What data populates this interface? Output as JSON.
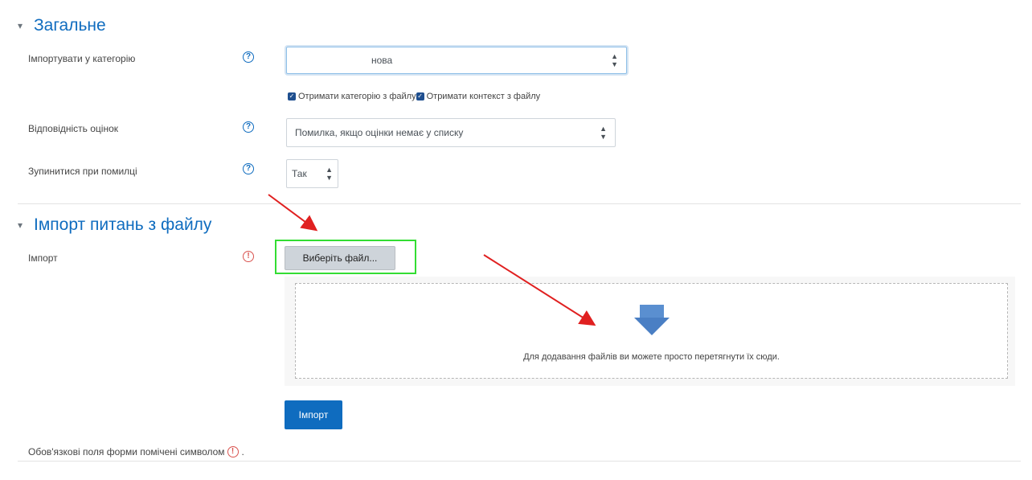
{
  "general": {
    "title": "Загальне",
    "chevron": "chevron-down-icon",
    "import_category": {
      "label": "Імпортувати у категорію",
      "value": "нова",
      "help": "?"
    },
    "checkboxes": [
      {
        "label": "Отримати категорію з файлу",
        "checked": true
      },
      {
        "label": "Отримати контекст з файлу",
        "checked": true
      }
    ],
    "grade_match": {
      "label": "Відповідність оцінок",
      "value": "Помилка, якщо оцінки немає у списку",
      "help": "?"
    },
    "stop_on_error": {
      "label": "Зупинитися при помилці",
      "value": "Так",
      "help": "?"
    }
  },
  "import_section": {
    "title": "Імпорт питань з файлу",
    "chevron": "chevron-down-icon",
    "import_label": "Імпорт",
    "required_icon": "!",
    "choose_file_label": "Виберіть файл...",
    "dropzone_text": "Для додавання файлів ви можете просто перетягнути їх сюди.",
    "submit_label": "Імпорт"
  },
  "footer": {
    "required_note": "Обов'язкові поля форми помічені символом",
    "required_note_end": "."
  },
  "colors": {
    "accent": "#0f6cbf",
    "annotation_arrow": "#e02020",
    "highlight_box": "#33dd33",
    "required": "#d9534f"
  }
}
